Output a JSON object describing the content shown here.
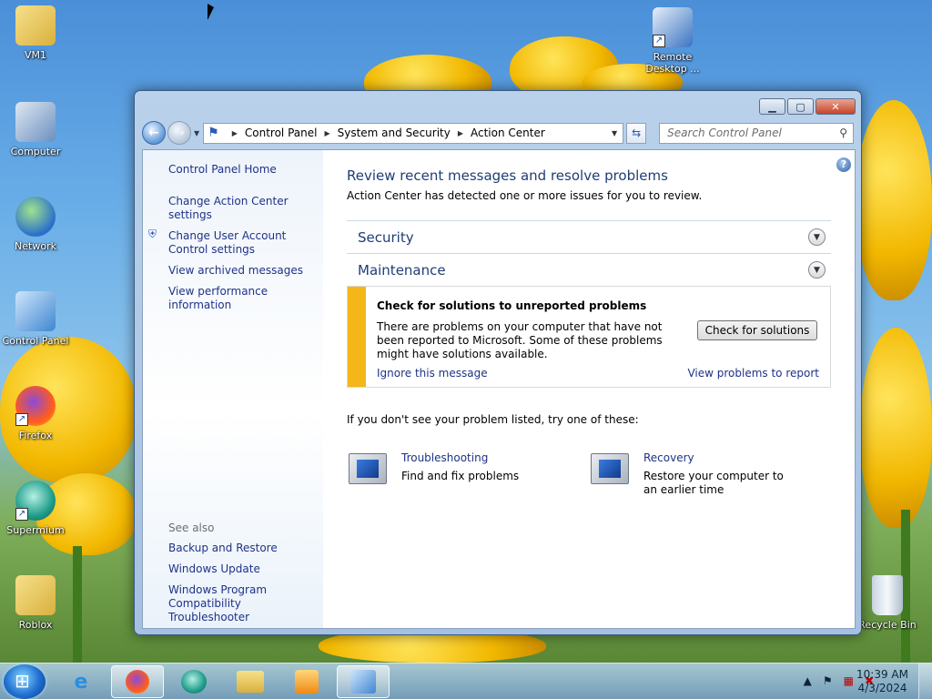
{
  "desktop": {
    "icons": [
      {
        "label": "VM1"
      },
      {
        "label": "Computer"
      },
      {
        "label": "Network"
      },
      {
        "label": "Control Panel"
      },
      {
        "label": "Firefox"
      },
      {
        "label": "Supermium"
      },
      {
        "label": "Roblox"
      },
      {
        "label": "Remote Desktop ..."
      },
      {
        "label": "Recycle Bin"
      }
    ]
  },
  "window": {
    "controls": {
      "minimize": "▁",
      "maximize": "▢",
      "close": "✕"
    },
    "address": {
      "crumbs": [
        "Control Panel",
        "System and Security",
        "Action Center"
      ]
    },
    "search": {
      "placeholder": "Search Control Panel"
    },
    "left_pane": {
      "home": "Control Panel Home",
      "links": [
        "Change Action Center settings",
        "Change User Account Control settings",
        "View archived messages",
        "View performance information"
      ],
      "see_also_header": "See also",
      "see_also": [
        "Backup and Restore",
        "Windows Update",
        "Windows Program Compatibility Troubleshooter"
      ]
    },
    "main": {
      "title": "Review recent messages and resolve problems",
      "subtitle": "Action Center has detected one or more issues for you to review.",
      "sections": [
        {
          "label": "Security"
        },
        {
          "label": "Maintenance"
        }
      ],
      "message": {
        "title": "Check for solutions to unreported problems",
        "description": "There are problems on your computer that have not been reported to Microsoft. Some of these problems might have solutions available.",
        "button": "Check for solutions",
        "ignore": "Ignore this message",
        "view": "View problems to report"
      },
      "try_text": "If you don't see your problem listed, try one of these:",
      "tools": [
        {
          "title": "Troubleshooting",
          "desc": "Find and fix problems"
        },
        {
          "title": "Recovery",
          "desc": "Restore your computer to an earlier time"
        }
      ]
    }
  },
  "taskbar": {
    "time": "10:39 AM",
    "date": "4/3/2024"
  },
  "colors": {
    "link": "#1e3287",
    "title": "#1e3e75",
    "warning_bar": "#f3b71a"
  }
}
